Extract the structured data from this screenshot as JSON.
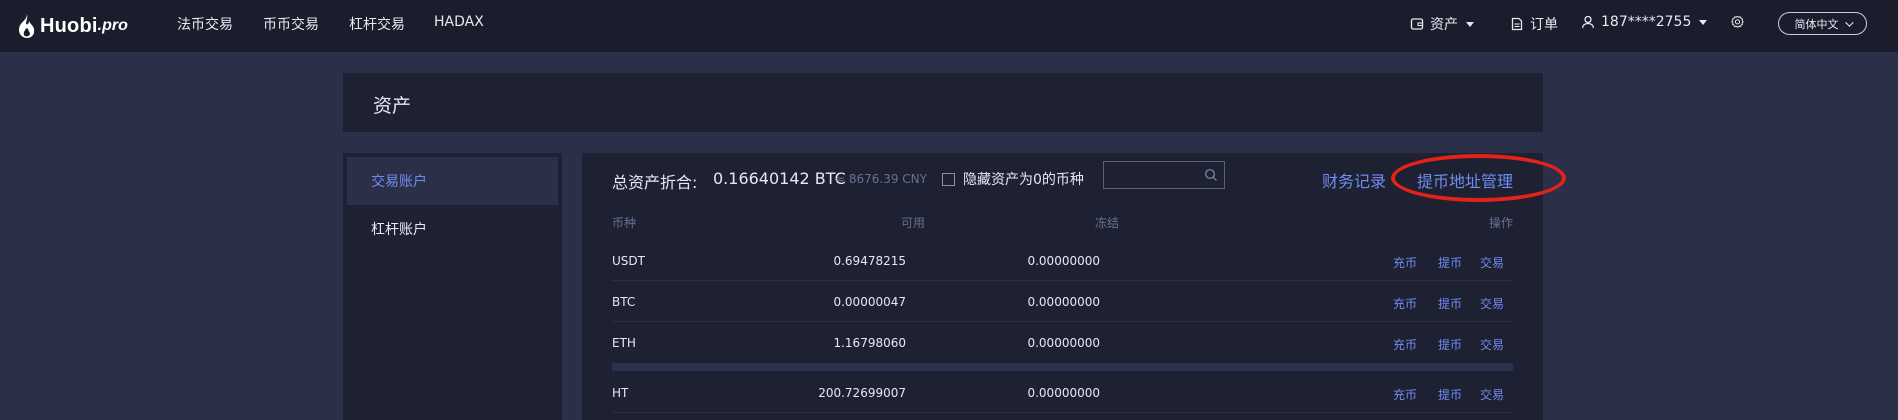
{
  "header": {
    "logo_text": "Huobi",
    "logo_suffix": ".pro",
    "nav": [
      "法币交易",
      "币币交易",
      "杠杆交易",
      "HADAX"
    ],
    "assets_label": "资产",
    "orders_label": "订单",
    "user_label": "187****2755",
    "language_label": "简体中文"
  },
  "page": {
    "title": "资产"
  },
  "sidebar": {
    "items": [
      {
        "label": "交易账户",
        "active": true
      },
      {
        "label": "杠杆账户",
        "active": false
      }
    ]
  },
  "summary": {
    "total_label": "总资产折合:",
    "btc_value": "0.16640142 BTC",
    "cny_value": "≈ 8676.39 CNY",
    "hide_zero_label": "隐藏资产为0的币种",
    "search_placeholder": "",
    "finance_records_label": "财务记录",
    "withdraw_address_label": "提币地址管理"
  },
  "table": {
    "headers": {
      "coin": "币种",
      "available": "可用",
      "frozen": "冻结",
      "actions": "操作"
    },
    "actions": {
      "deposit": "充币",
      "withdraw": "提币",
      "trade": "交易"
    },
    "rows": [
      {
        "coin": "USDT",
        "available": "0.69478215",
        "frozen": "0.00000000"
      },
      {
        "coin": "BTC",
        "available": "0.00000047",
        "frozen": "0.00000000"
      },
      {
        "coin": "ETH",
        "available": "1.16798060",
        "frozen": "0.00000000"
      },
      {
        "coin": "HT",
        "available": "200.72699007",
        "frozen": "0.00000000"
      }
    ]
  },
  "colors": {
    "page_bg": "#2b2f47",
    "nav_bg": "#1a1d2b",
    "panel_bg": "#1e2131",
    "link": "#6f8cf3",
    "annotation_circle": "#e3221b"
  }
}
